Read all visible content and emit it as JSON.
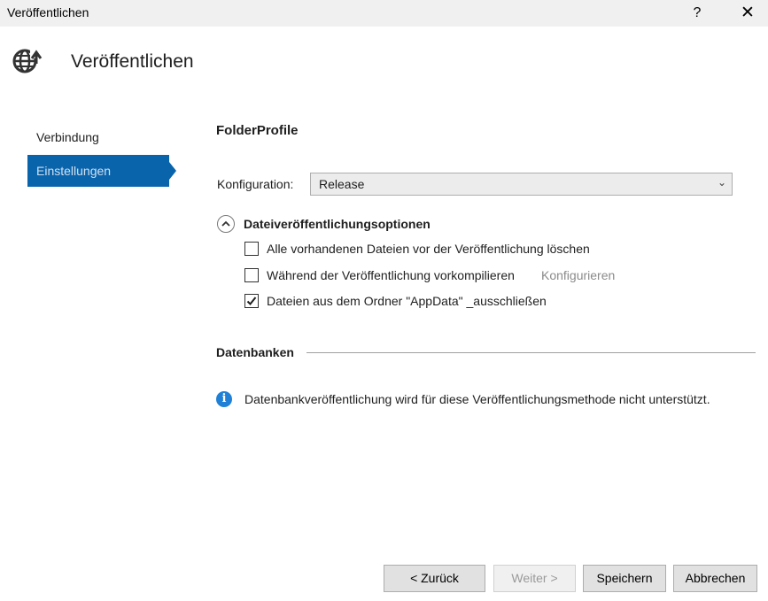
{
  "window": {
    "title": "Veröffentlichen",
    "help_glyph": "?",
    "close_glyph": "✕"
  },
  "header": {
    "icon": "globe-publish-icon",
    "title": "Veröffentlichen"
  },
  "nav": {
    "items": [
      {
        "label": "Verbindung",
        "selected": false
      },
      {
        "label": "Einstellungen",
        "selected": true
      }
    ]
  },
  "settings": {
    "profile_name": "FolderProfile",
    "configuration": {
      "label": "Konfiguration:",
      "value": "Release"
    },
    "file_publish_options": {
      "title": "Dateiveröffentlichungsoptionen",
      "expanded": true,
      "options": [
        {
          "label": "Alle vorhandenen Dateien vor der Veröffentlichung löschen",
          "checked": false
        },
        {
          "label": "Während der Veröffentlichung vorkompilieren",
          "checked": false,
          "link": "Konfigurieren"
        },
        {
          "label": "Dateien aus dem Ordner \"AppData\" _ausschließen",
          "checked": true
        }
      ]
    },
    "databases": {
      "title": "Datenbanken",
      "info": "Datenbankveröffentlichung wird für diese Veröffentlichungsmethode nicht unterstützt."
    }
  },
  "footer": {
    "back": "< Zurück",
    "next": "Weiter >",
    "save": "Speichern",
    "cancel": "Abbrechen"
  },
  "colors": {
    "accent": "#0a64ac",
    "info": "#1f80d6",
    "titlebar": "#f0f0f0"
  }
}
